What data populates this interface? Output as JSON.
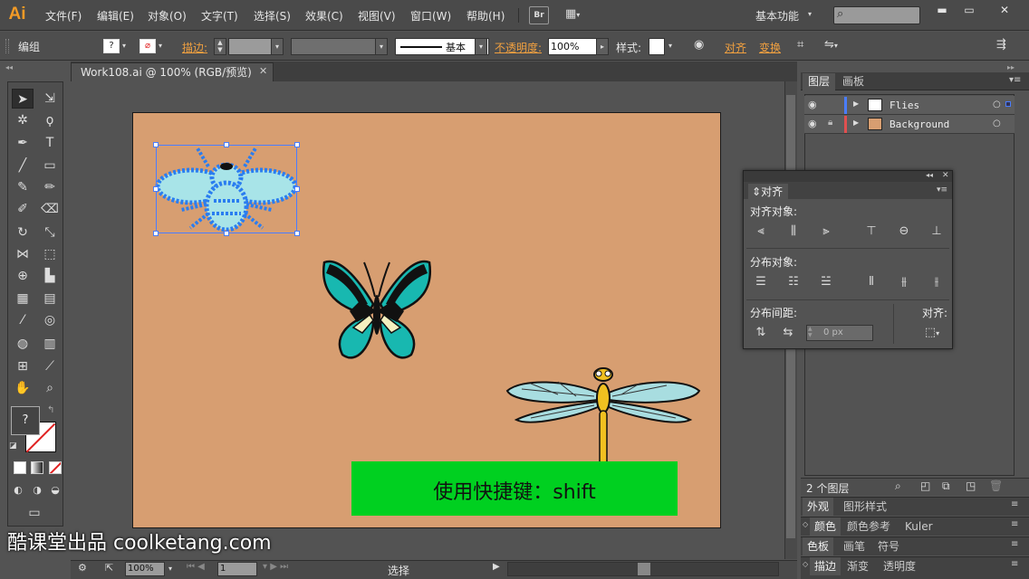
{
  "app": {
    "logo": "Ai"
  },
  "menubar": {
    "items": [
      "文件(F)",
      "编辑(E)",
      "对象(O)",
      "文字(T)",
      "选择(S)",
      "效果(C)",
      "视图(V)",
      "窗口(W)",
      "帮助(H)"
    ],
    "bridge_label": "Br",
    "workspace": "基本功能",
    "search_placeholder": ""
  },
  "control_bar": {
    "selection_label": "编组",
    "stroke_label": "描边:",
    "stroke_style_label": "基本",
    "opacity_label": "不透明度:",
    "opacity_value": "100%",
    "style_label": "样式:",
    "align_label": "对齐",
    "transform_label": "变换"
  },
  "document": {
    "tab_title": "Work108.ai @ 100% (RGB/预览)"
  },
  "toolbar": {
    "fill_stroke_label": "?"
  },
  "canvas": {
    "caption": "使用快捷键：shift",
    "artboard_color": "#d79e71",
    "caption_color": "#00d020"
  },
  "status_bar": {
    "zoom": "100%",
    "page": "1",
    "tool": "选择"
  },
  "layers_panel": {
    "tabs": [
      "图层",
      "画板"
    ],
    "layers": [
      {
        "name": "Flies",
        "color": "#4a7dff"
      },
      {
        "name": "Background",
        "color": "#e05050"
      }
    ],
    "count": "2 个图层"
  },
  "align_panel": {
    "title": "对齐",
    "align_objects": "对齐对象:",
    "distribute_objects": "分布对象:",
    "distribute_spacing": "分布间距:",
    "align_to": "对齐:",
    "spacing_value": "0 px"
  },
  "panel_groups": [
    {
      "tabs": [
        "外观",
        "图形样式"
      ]
    },
    {
      "tabs": [
        "颜色",
        "颜色参考",
        "Kuler"
      ]
    },
    {
      "tabs": [
        "色板",
        "画笔",
        "符号"
      ]
    },
    {
      "tabs": [
        "描边",
        "渐变",
        "透明度"
      ]
    }
  ],
  "watermark": "酷课堂出品 coolketang.com"
}
